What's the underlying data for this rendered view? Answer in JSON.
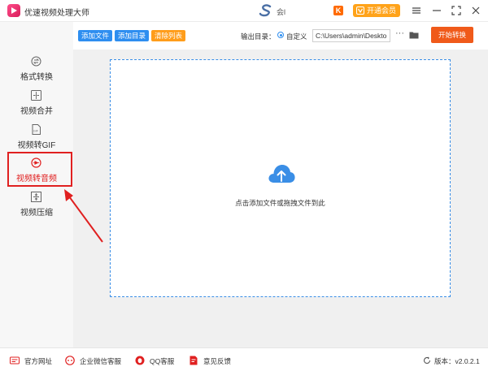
{
  "app": {
    "title": "优速视频处理大师"
  },
  "header": {
    "user_name": "会l",
    "vip_label": "开通会员"
  },
  "toolbar": {
    "add_file": "添加文件",
    "add_dir": "添加目录",
    "clear_list": "清除列表",
    "output_label": "输出目录：",
    "custom_label": "自定义",
    "output_path": "C:\\Users\\admin\\Deskto",
    "more": "···",
    "start": "开始转换"
  },
  "sidebar": {
    "items": [
      {
        "label": "格式转换",
        "icon": "format-convert-icon"
      },
      {
        "label": "视频合并",
        "icon": "video-merge-icon"
      },
      {
        "label": "视频转GIF",
        "icon": "gif-icon"
      },
      {
        "label": "视频转音频",
        "icon": "audio-convert-icon",
        "active": true
      },
      {
        "label": "视频压缩",
        "icon": "compress-icon"
      }
    ]
  },
  "main": {
    "drop_hint": "点击添加文件或拖拽文件到此"
  },
  "footer": {
    "links": [
      {
        "label": "官方网址",
        "icon": "website-icon"
      },
      {
        "label": "企业微信客服",
        "icon": "wechat-service-icon"
      },
      {
        "label": "QQ客服",
        "icon": "qq-icon"
      },
      {
        "label": "意见反馈",
        "icon": "feedback-icon"
      }
    ],
    "version": "版本：v2.0.2.1"
  },
  "colors": {
    "accent_blue": "#2e8ef0",
    "accent_orange": "#ff9d1b",
    "start_red": "#f05a1a",
    "highlight_red": "#e02020",
    "vip_orange": "#ffa31a"
  }
}
